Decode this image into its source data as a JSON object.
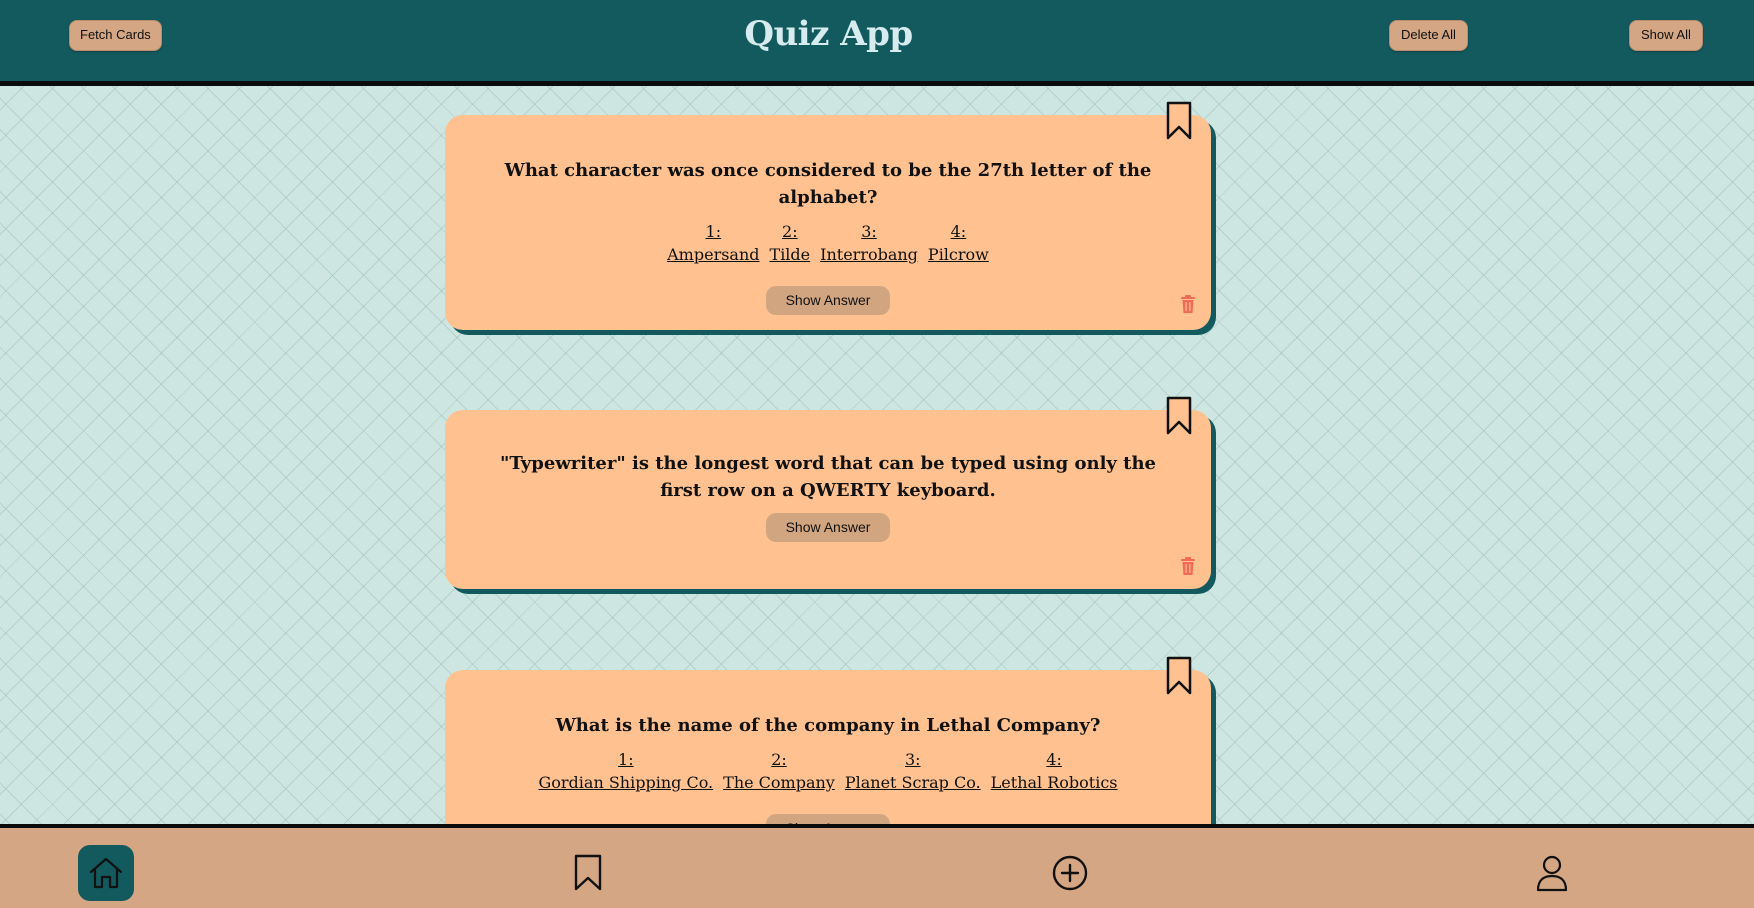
{
  "header": {
    "title": "Quiz App",
    "fetch_label": "Fetch Cards",
    "delete_all_label": "Delete All",
    "show_all_label": "Show All"
  },
  "cards": [
    {
      "question": "What character was once considered to be the 27th letter of the alphabet?",
      "answers": [
        {
          "num": "1:",
          "text": "Ampersand"
        },
        {
          "num": "2:",
          "text": "Tilde"
        },
        {
          "num": "3:",
          "text": "Interrobang"
        },
        {
          "num": "4:",
          "text": "Pilcrow"
        }
      ],
      "show_answer_label": "Show Answer"
    },
    {
      "question": "\"Typewriter\" is the longest word that can be typed using only the first row on a QWERTY keyboard.",
      "show_answer_label": "Show Answer"
    },
    {
      "question": "What is the name of the company in Lethal Company?",
      "answers": [
        {
          "num": "1:",
          "text": "Gordian Shipping Co."
        },
        {
          "num": "2:",
          "text": "The Company"
        },
        {
          "num": "3:",
          "text": "Planet Scrap Co."
        },
        {
          "num": "4:",
          "text": "Lethal Robotics"
        }
      ],
      "show_answer_label": "Show Answer"
    }
  ],
  "footer_nav": [
    {
      "icon": "home-icon",
      "active": true
    },
    {
      "icon": "bookmark-icon",
      "active": false
    },
    {
      "icon": "add-circle-icon",
      "active": false
    },
    {
      "icon": "user-icon",
      "active": false
    }
  ],
  "colors": {
    "header_bg": "#135a5e",
    "card_bg": "#ffc18f",
    "button_bg": "#d4a684",
    "trash": "#f06a55",
    "page_bg": "#cde6e1"
  }
}
